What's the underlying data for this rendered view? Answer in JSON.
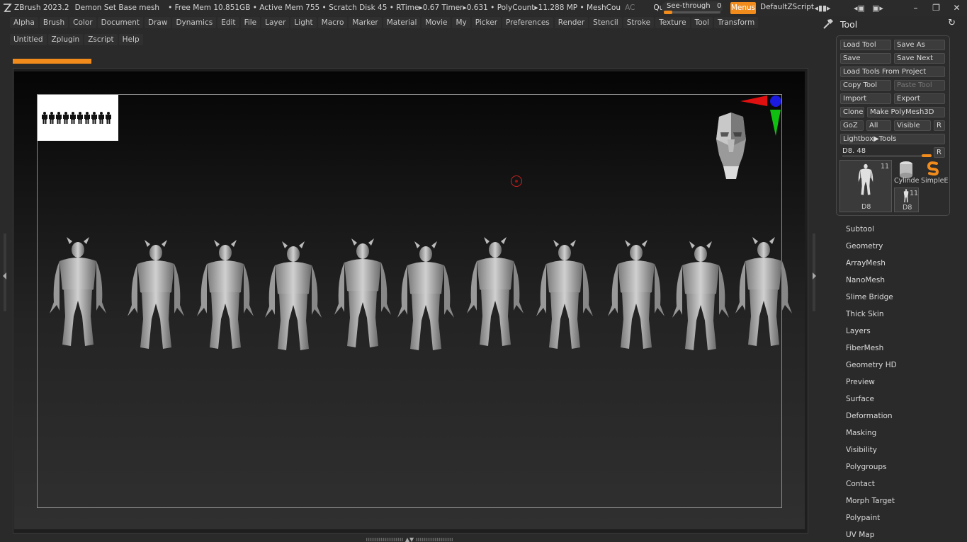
{
  "titlebar": {
    "app": "ZBrush 2023.2",
    "document": "Demon Set Base mesh",
    "stats": "• Free Mem 10.851GB • Active Mem 755 • Scratch Disk 45 • RTime▸0.67 Timer▸0.631 • PolyCount▸11.288 MP • MeshCou",
    "ac": "AC",
    "quicksave": "QuickSave",
    "seethrough_label": "See-through",
    "seethrough_value": "0",
    "seethrough_level": 0,
    "menus": "Menus",
    "zscript": "DefaultZScript"
  },
  "menubar": {
    "row1": [
      "Alpha",
      "Brush",
      "Color",
      "Document",
      "Draw",
      "Dynamics",
      "Edit",
      "File",
      "Layer",
      "Light",
      "Macro",
      "Marker",
      "Material",
      "Movie",
      "My",
      "Picker",
      "Preferences",
      "Render",
      "Stencil",
      "Stroke",
      "Texture",
      "Tool",
      "Transform"
    ],
    "row2": [
      "Untitled",
      "Zplugin",
      "Zscript",
      "Help"
    ]
  },
  "tool": {
    "title": "Tool",
    "load_tool": "Load Tool",
    "save_as": "Save As",
    "save": "Save",
    "save_next": "Save Next",
    "load_from_project": "Load Tools From Project",
    "copy_tool": "Copy Tool",
    "paste_tool": "Paste Tool",
    "import": "Import",
    "export": "Export",
    "clone": "Clone",
    "make_polymesh": "Make PolyMesh3D",
    "goz": "GoZ",
    "all": "All",
    "visible": "Visible",
    "r": "R",
    "lightbox": "Lightbox▶Tools",
    "slider_label": "D8. 48",
    "slider_level": 0.9,
    "current_count": "11",
    "current_name": "D8",
    "cylinder": "Cylinde",
    "simple": "SimpleE",
    "small_count": "11",
    "small_name": "D8"
  },
  "subpalettes": [
    "Subtool",
    "Geometry",
    "ArrayMesh",
    "NanoMesh",
    "Slime Bridge",
    "Thick Skin",
    "Layers",
    "FiberMesh",
    "Geometry HD",
    "Preview",
    "Surface",
    "Deformation",
    "Masking",
    "Visibility",
    "Polygroups",
    "Contact",
    "Morph Target",
    "Polypaint",
    "UV Map"
  ],
  "colors": {
    "accent": "#f08b1c",
    "gizmo_x": "#e01010",
    "gizmo_y": "#10c010",
    "gizmo_z": "#1010e0"
  },
  "progress": 1
}
